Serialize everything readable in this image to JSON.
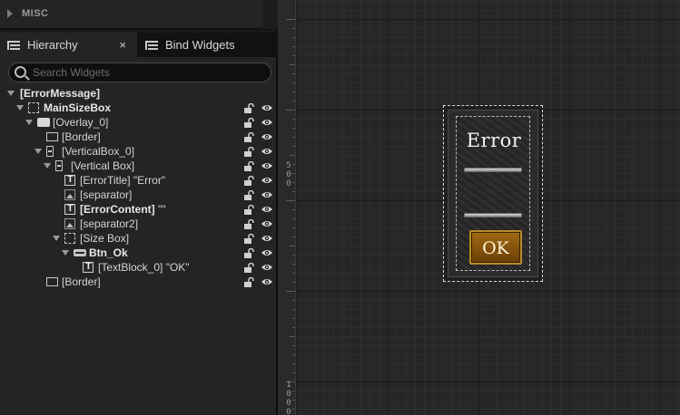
{
  "misc": {
    "label": "MISC"
  },
  "tabs": [
    {
      "label": "Hierarchy",
      "icon": "hierarchy-icon",
      "active": true,
      "close": "×"
    },
    {
      "label": "Bind Widgets",
      "icon": "bind-widgets-icon",
      "active": false
    }
  ],
  "search": {
    "placeholder": "Search Widgets",
    "value": ""
  },
  "tree": [
    {
      "label": "[ErrorMessage]",
      "bold": true,
      "expanded": true,
      "icon": null
    },
    {
      "label": "MainSizeBox",
      "bold": true,
      "expanded": true,
      "icon": "size-box-icon"
    },
    {
      "label": "[Overlay_0]",
      "bold": false,
      "expanded": true,
      "icon": "overlay-icon"
    },
    {
      "label": "[Border]",
      "bold": false,
      "expanded": null,
      "icon": "border-icon"
    },
    {
      "label": "[VerticalBox_0]",
      "bold": false,
      "expanded": true,
      "icon": "vertical-box-icon"
    },
    {
      "label": "[Vertical Box]",
      "bold": false,
      "expanded": true,
      "icon": "vertical-box-icon"
    },
    {
      "label": "[ErrorTitle] \"Error\"",
      "bold": false,
      "expanded": null,
      "icon": "text-block-icon"
    },
    {
      "label": "[separator]",
      "bold": false,
      "expanded": null,
      "icon": "image-icon"
    },
    {
      "label": "[ErrorContent] \"\"",
      "bold": false,
      "boldPart": "[ErrorContent]",
      "rest": " \"\"",
      "expanded": null,
      "icon": "text-block-icon"
    },
    {
      "label": "[separator2]",
      "bold": false,
      "expanded": null,
      "icon": "image-icon"
    },
    {
      "label": "[Size Box]",
      "bold": false,
      "expanded": true,
      "icon": "size-box-icon"
    },
    {
      "label": "Btn_Ok",
      "bold": true,
      "expanded": true,
      "icon": "button-icon"
    },
    {
      "label": "[TextBlock_0] \"OK\"",
      "bold": false,
      "expanded": null,
      "icon": "text-block-icon"
    },
    {
      "label": "[Border]",
      "bold": false,
      "expanded": null,
      "icon": "border-icon"
    }
  ],
  "ruler": {
    "mark_top": "500",
    "mark_bottom": "1000"
  },
  "preview": {
    "title": "Error",
    "button_label": "OK",
    "button_color": "#8a5410",
    "button_border": "#b88a2a"
  }
}
